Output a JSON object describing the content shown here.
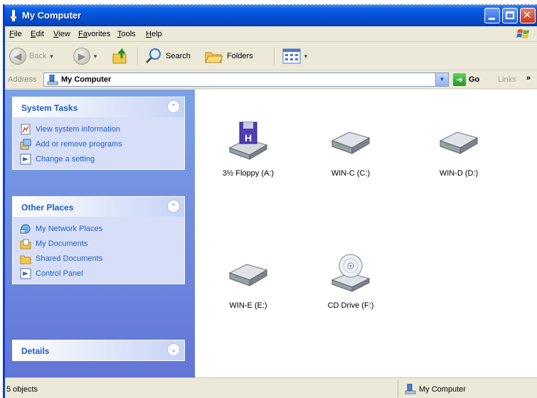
{
  "window": {
    "title": "My Computer"
  },
  "menu": {
    "items": [
      {
        "mnemonic": "F",
        "rest": "ile"
      },
      {
        "mnemonic": "E",
        "rest": "dit"
      },
      {
        "mnemonic": "V",
        "rest": "iew"
      },
      {
        "mnemonic": "Fa",
        "rest": "vorites"
      },
      {
        "mnemonic": "T",
        "rest": "ools"
      },
      {
        "mnemonic": "H",
        "rest": "elp"
      }
    ]
  },
  "toolbar": {
    "back_label": "Back",
    "search_label": "Search",
    "folders_label": "Folders"
  },
  "address": {
    "label": "Address",
    "value": "My Computer",
    "go_label": "Go",
    "links_label": "Links",
    "links_chevron": "»"
  },
  "tasks": {
    "system": {
      "title": "System Tasks",
      "items": [
        "View system information",
        "Add or remove programs",
        "Change a setting"
      ]
    },
    "other": {
      "title": "Other Places",
      "items": [
        "My Network Places",
        "My Documents",
        "Shared Documents",
        "Control Panel"
      ]
    },
    "details": {
      "title": "Details"
    }
  },
  "drives": [
    {
      "label": "3½ Floppy (A:)",
      "icon": "floppy-drive-icon"
    },
    {
      "label": "WIN-C (C:)",
      "icon": "hard-drive-icon"
    },
    {
      "label": "WIN-D (D:)",
      "icon": "hard-drive-icon"
    },
    {
      "label": "WIN-E (E:)",
      "icon": "hard-drive-icon"
    },
    {
      "label": "CD Drive (F:)",
      "icon": "cd-drive-icon"
    }
  ],
  "status": {
    "objects": "5 objects",
    "location": "My Computer"
  },
  "colors": {
    "titlebar": "#0553d6",
    "taskpane": "#6f8ee0",
    "task_link": "#215dc6"
  }
}
